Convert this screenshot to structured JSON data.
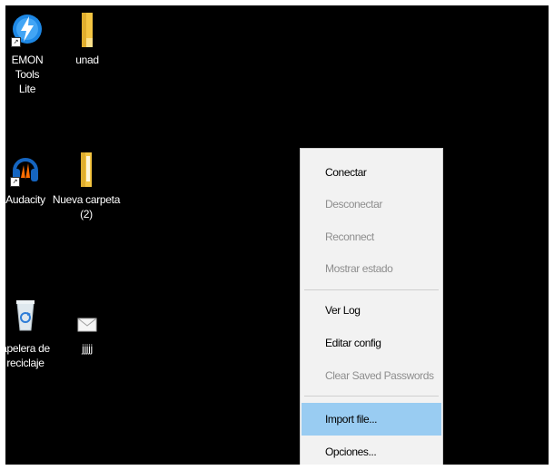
{
  "desktop_icons": [
    {
      "label_line1": "EMON Tools",
      "label_line2": "Lite",
      "icon": "daemon-tools-lightning-icon"
    },
    {
      "label_line1": "unad",
      "label_line2": "",
      "icon": "folder-icon"
    },
    {
      "label_line1": "Audacity",
      "label_line2": "",
      "icon": "audacity-headphones-icon"
    },
    {
      "label_line1": "Nueva carpeta (2)",
      "label_line2": "",
      "icon": "folder-icon"
    },
    {
      "label_line1": "apelera de",
      "label_line2": "reciclaje",
      "icon": "recycle-bin-icon"
    },
    {
      "label_line1": "jjjjj",
      "label_line2": "",
      "icon": "envelope-file-icon"
    }
  ],
  "context_menu": {
    "items": [
      {
        "label": "Conectar",
        "state": "enabled"
      },
      {
        "label": "Desconectar",
        "state": "disabled"
      },
      {
        "label": "Reconnect",
        "state": "disabled"
      },
      {
        "label": "Mostrar estado",
        "state": "disabled"
      },
      {
        "label": "Ver Log",
        "state": "enabled"
      },
      {
        "label": "Editar config",
        "state": "enabled"
      },
      {
        "label": "Clear Saved Passwords",
        "state": "disabled"
      },
      {
        "label": "Import file...",
        "state": "highlighted"
      },
      {
        "label": "Opciones...",
        "state": "enabled"
      }
    ]
  },
  "colors": {
    "desktop": "#000000",
    "menu_background": "#f2f2f2",
    "menu_highlight": "#99ccf2",
    "disabled_text": "#8e8e8e"
  }
}
